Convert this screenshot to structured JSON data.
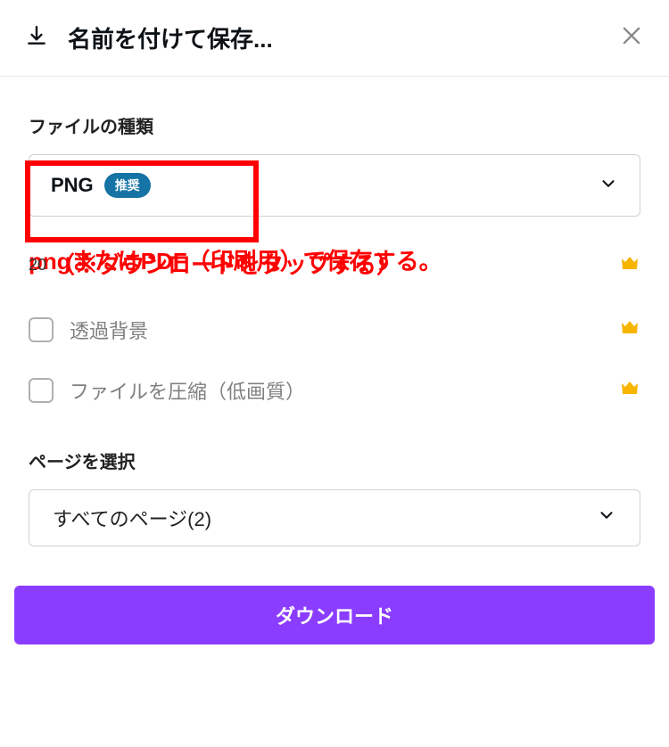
{
  "header": {
    "title": "名前を付けて保存..."
  },
  "filetype": {
    "label": "ファイルの種類",
    "value": "PNG",
    "badge": "推奨"
  },
  "annotation": {
    "line1": "pngまたはPDF（印刷用）で保存する。",
    "line2": "（※ダウンロードをタップする）"
  },
  "size_prefix": "20",
  "options": {
    "transparent": "透過背景",
    "compress": "ファイルを圧縮（低画質）"
  },
  "pages": {
    "label": "ページを選択",
    "value": "すべてのページ(2)"
  },
  "download": "ダウンロード"
}
